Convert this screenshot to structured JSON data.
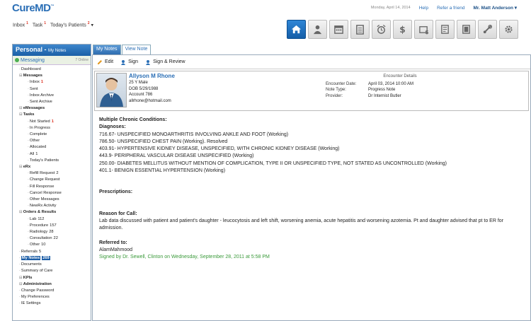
{
  "app": {
    "logo": "CureMD"
  },
  "topbar": {
    "date": "Monday, April 14, 2014",
    "help": "Help",
    "refer": "Refer a friend",
    "user": "Mr. Matt Anderson"
  },
  "subbar": {
    "inbox": "Inbox",
    "inbox_badge": "1",
    "task": "Task",
    "task_badge": "1",
    "today": "Today's Patients",
    "today_badge": "2"
  },
  "nav_icons": [
    "home-icon",
    "person-icon",
    "calendar-icon",
    "clipboard-icon",
    "alarm-icon",
    "dollar-icon",
    "billing-icon",
    "document-icon",
    "film-icon",
    "tools-icon",
    "gear-icon"
  ],
  "accent": "#1d6fc2",
  "left": {
    "title": "Personal",
    "subtitle": "My Notes",
    "messaging": "Messaging",
    "online": "7 Online",
    "tree": [
      {
        "label": "Dashboard",
        "level": 0
      },
      {
        "label": "Messages",
        "level": 0,
        "bold": true
      },
      {
        "label": "Inbox",
        "level": 1,
        "badge": "1"
      },
      {
        "label": "Sent",
        "level": 1
      },
      {
        "label": "Inbox Archive",
        "level": 1
      },
      {
        "label": "Sent Archive",
        "level": 1
      },
      {
        "label": "eMessages",
        "level": 0,
        "bold": true
      },
      {
        "label": "Tasks",
        "level": 0,
        "bold": true
      },
      {
        "label": "Not Started",
        "level": 1,
        "badge": "1"
      },
      {
        "label": "In Progress",
        "level": 1
      },
      {
        "label": "Complete",
        "level": 1
      },
      {
        "label": "Other",
        "level": 1
      },
      {
        "label": "Allocated",
        "level": 1
      },
      {
        "label": "All",
        "level": 1,
        "count": "1"
      },
      {
        "label": "Today's Patients",
        "level": 1
      },
      {
        "label": "eRx",
        "level": 0,
        "bold": true
      },
      {
        "label": "Refill Request",
        "level": 1,
        "count": "2"
      },
      {
        "label": "Change Request",
        "level": 1
      },
      {
        "label": "Fill Response",
        "level": 1
      },
      {
        "label": "Cancel Response",
        "level": 1
      },
      {
        "label": "Other Messages",
        "level": 1
      },
      {
        "label": "NewRx Activity",
        "level": 1
      },
      {
        "label": "Orders & Results",
        "level": 0,
        "bold": true
      },
      {
        "label": "Lab",
        "level": 1,
        "count": "112"
      },
      {
        "label": "Procedure",
        "level": 1,
        "count": "157"
      },
      {
        "label": "Radiology",
        "level": 1,
        "count": "28"
      },
      {
        "label": "Consultation",
        "level": 1,
        "count": "22"
      },
      {
        "label": "Other",
        "level": 1,
        "count": "10"
      },
      {
        "label": "Referrals",
        "level": 0,
        "count": "5"
      },
      {
        "label": "My Notes",
        "level": 0,
        "count": "269",
        "selected": true
      },
      {
        "label": "Documents",
        "level": 0
      },
      {
        "label": "Summary of Care",
        "level": 0
      },
      {
        "label": "KPIs",
        "level": 0,
        "bold": true
      },
      {
        "label": "Administration",
        "level": 0,
        "bold": true
      },
      {
        "label": "Change Password",
        "level": 0
      },
      {
        "label": "My Preferences",
        "level": 0
      },
      {
        "label": "IE Settings",
        "level": 0
      }
    ]
  },
  "tabs": {
    "my_notes": "My Notes",
    "view_note": "View Note"
  },
  "toolbar": {
    "edit": "Edit",
    "sign": "Sign",
    "sign_review": "Sign & Review"
  },
  "patient": {
    "name": "Allyson M Rhone",
    "age_sex": "25 Y Male",
    "dob": "DOB 5/29/1988",
    "account": "Account 786",
    "email": "allrhone@hotmail.com"
  },
  "encounter": {
    "title": "Encounter Details",
    "date_label": "Encounter Date:",
    "date": "April 03, 2014 10:00 AM",
    "type_label": "Note Type:",
    "type": "Progress Note",
    "provider_label": "Provider:",
    "provider": "Dr Internist Butler"
  },
  "note": {
    "heading": "Multiple Chronic Conditions:",
    "diagnoses_label": "Diagnoses:",
    "diagnoses": [
      "716.67- UNSPECIFIED MONOARTHRITIS INVOLVING ANKLE AND FOOT (Working)",
      "786.50- UNSPECIFIED CHEST PAIN (Working). Resolved",
      "403.91- HYPERTENSIVE KIDNEY DISEASE, UNSPECIFIED, WITH CHRONIC KIDNEY DISEASE (Working)",
      "443.9- PERIPHERAL VASCULAR DISEASE UNSPECIFIED (Working)",
      "250.00- DIABETES MELLITUS WITHOUT MENTION OF COMPLICATION, TYPE II OR UNSPECIFIED TYPE, NOT STATED AS UNCONTROLLED (Working)",
      "401.1- BENIGN ESSENTIAL HYPERTENSION (Working)"
    ],
    "prescriptions_label": "Prescriptions:",
    "reason_label": "Reason for Call:",
    "reason": "Lab data discussed with patient and patient's daughter - leucocytosis and left shift, worsening anemia, acute hepatitis and worsening azotemia. Pt and daughter advised that pt to ER for admission.",
    "referred_label": "Referred to:",
    "referred": "AlamMahmood",
    "signed": "Signed by Dr. Sewell, Clinton on Wednesday, September 28, 2011 at 5:58 PM"
  }
}
